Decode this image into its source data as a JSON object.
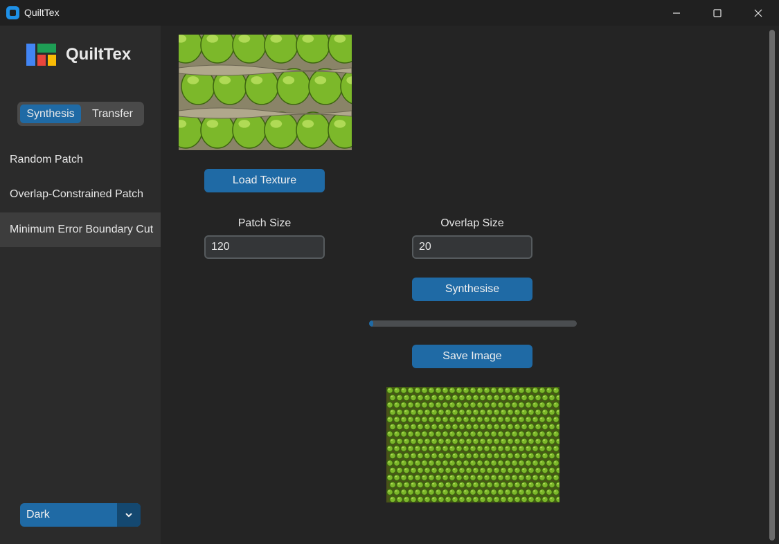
{
  "window": {
    "title": "QuiltTex",
    "controls": {
      "minimize": "minimize-icon",
      "maximize": "maximize-icon",
      "close": "close-icon"
    }
  },
  "sidebar": {
    "brand": "QuiltTex",
    "mode_toggle": {
      "options": [
        "Synthesis",
        "Transfer"
      ],
      "selected": "Synthesis"
    },
    "items": [
      {
        "label": "Random Patch",
        "selected": false
      },
      {
        "label": "Overlap-Constrained Patch",
        "selected": false
      },
      {
        "label": "Minimum Error Boundary Cut",
        "selected": true
      }
    ],
    "theme": {
      "value": "Dark",
      "icon": "chevron-down-icon"
    }
  },
  "main": {
    "load_button": "Load Texture",
    "patch_size": {
      "label": "Patch Size",
      "value": "120"
    },
    "overlap_size": {
      "label": "Overlap Size",
      "value": "20"
    },
    "synthesise_button": "Synthesise",
    "progress": 0.02,
    "save_button": "Save Image"
  },
  "colors": {
    "accent": "#1f6aa5",
    "sidebar_bg": "#2b2b2b",
    "main_bg": "#242424",
    "selected_item": "#3d3d3d"
  }
}
